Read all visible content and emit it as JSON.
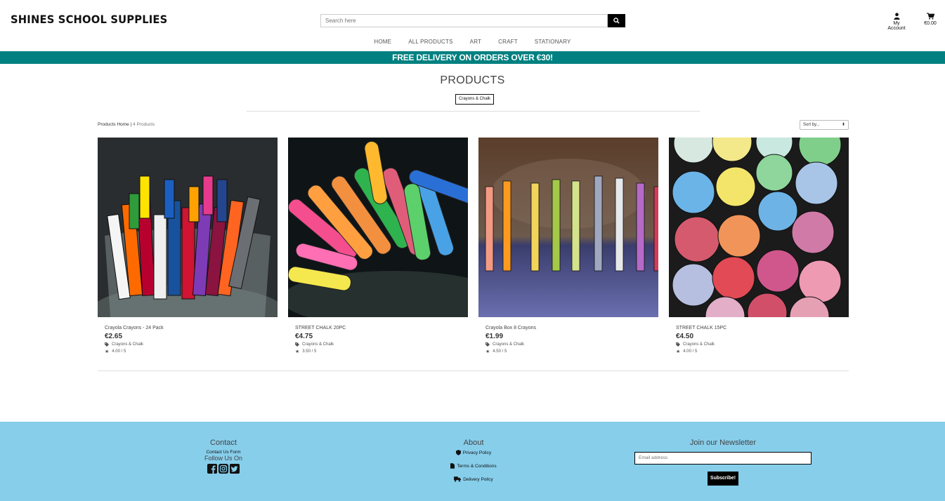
{
  "header": {
    "brand": "SHINES SCHOOL SUPPLIES",
    "search_placeholder": "Search here",
    "account_label": "My Account",
    "cart_total": "€0.00",
    "nav": [
      "HOME",
      "ALL PRODUCTS",
      "ART",
      "CRAFT",
      "STATIONARY"
    ]
  },
  "banner": {
    "text": "FREE DELIVERY ON ORDERS OVER €30!"
  },
  "main": {
    "title": "PRODUCTS",
    "category_badge": "Crayons & Chalk",
    "breadcrumb_home": "Products Home",
    "breadcrumb_sep": " | ",
    "breadcrumb_count": "4 Products",
    "sort_label": "Sort by..."
  },
  "products": [
    {
      "name": "Crayola Crayons - 24 Pack",
      "price": "€2.65",
      "category": "Crayons & Chalk",
      "rating": "4.00 / 5"
    },
    {
      "name": "STREET CHALK 20PC",
      "price": "€4.75",
      "category": "Crayons & Chalk",
      "rating": "3.50 / 5"
    },
    {
      "name": "Crayola Box 8 Crayons",
      "price": "€1.99",
      "category": "Crayons & Chalk",
      "rating": "4.50 / 5"
    },
    {
      "name": "STREET CHALK 15PC",
      "price": "€4.50",
      "category": "Crayons & Chalk",
      "rating": "4.00 / 5"
    }
  ],
  "footer": {
    "contact_heading": "Contact",
    "contact_link": "Contact Us Form",
    "follow_label": "Follow Us On",
    "about_heading": "About",
    "privacy": "Privacy Policy",
    "terms": "Terms & Conditions",
    "delivery": "Delivery Policy",
    "newsletter_heading": "Join our Newsletter",
    "email_placeholder": "Email address",
    "subscribe_label": "Subscribe!"
  },
  "colors": {
    "banner": "#008080",
    "footer": "#87ceeb"
  }
}
